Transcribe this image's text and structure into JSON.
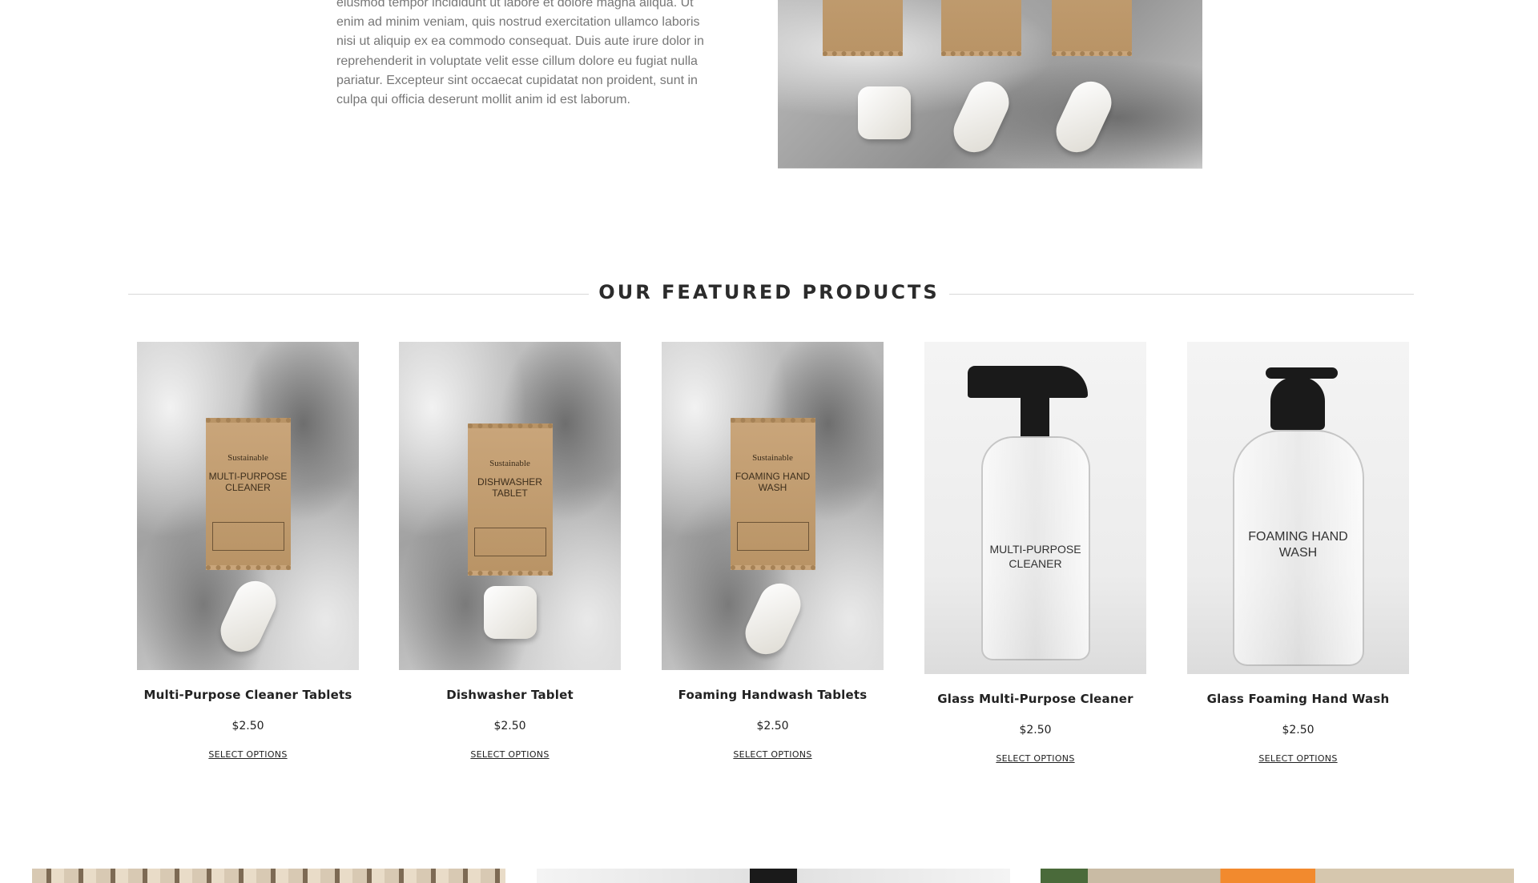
{
  "intro": {
    "text": "eiusmod tempor incididunt ut labore et dolore magna aliqua. Ut enim ad minim veniam, quis nostrud exercitation ullamco laboris nisi ut aliquip ex ea commodo consequat. Duis aute irure dolor in reprehenderit in voluptate velit esse cillum dolore eu fugiat nulla pariatur. Excepteur sint occaecat cupidatat non proident, sunt in culpa qui officia deserunt mollit anim id est laborum."
  },
  "featured": {
    "title": "OUR FEATURED PRODUCTS",
    "products": [
      {
        "name": "Multi-Purpose Cleaner Tablets",
        "price": "$2.50",
        "cta": "SELECT OPTIONS",
        "pack_brand": "Sustainable",
        "pack_label": "MULTI-PURPOSE CLEANER"
      },
      {
        "name": "Dishwasher Tablet",
        "price": "$2.50",
        "cta": "SELECT OPTIONS",
        "pack_brand": "Sustainable",
        "pack_label": "DISHWASHER TABLET"
      },
      {
        "name": "Foaming Handwash Tablets",
        "price": "$2.50",
        "cta": "SELECT OPTIONS",
        "pack_brand": "Sustainable",
        "pack_label": "FOAMING HAND WASH"
      },
      {
        "name": "Glass Multi-Purpose Cleaner",
        "price": "$2.50",
        "cta": "SELECT OPTIONS",
        "bottle_label": "MULTI-PURPOSE CLEANER"
      },
      {
        "name": "Glass Foaming Hand Wash",
        "price": "$2.50",
        "cta": "SELECT OPTIONS",
        "bottle_label": "FOAMING HAND WASH"
      }
    ]
  },
  "colors": {
    "text_dark": "#222222",
    "text_muted": "#777777",
    "rule": "#d9d9d9",
    "kraft": "#c9a57a"
  }
}
